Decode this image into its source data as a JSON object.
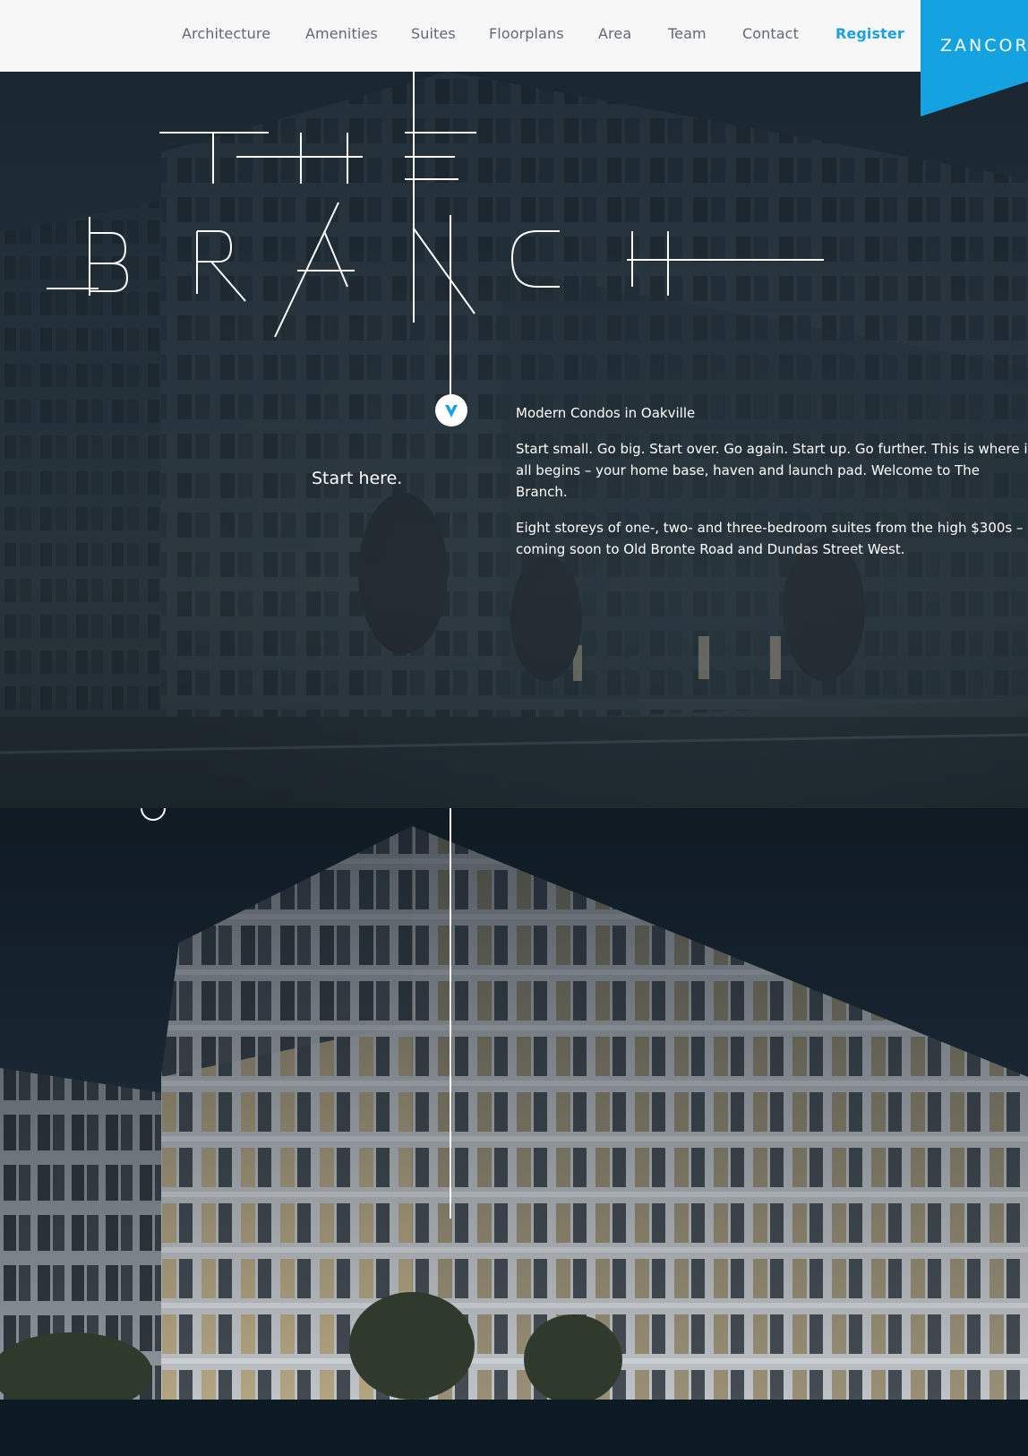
{
  "header": {
    "nav": [
      "Architecture",
      "Amenities",
      "Suites",
      "Floorplans",
      "Area",
      "Team",
      "Contact"
    ],
    "register_label": "Register",
    "logo_text": "ZANCOR",
    "colors": {
      "accent": "#1da1de",
      "nav_text": "#606a70",
      "header_bg": "#f7f7f7",
      "logo_bg": "#14a3e0"
    }
  },
  "hero": {
    "title_line1": "THE",
    "title_line2": "BRANCH",
    "start_label": "Start here.",
    "start_icon": "chevron-down-icon",
    "tagline": "Modern Condos in Oakville",
    "paragraph1": "Start small. Go big. Start over. Go again. Start up. Go further. This is where it all begins – your home base, haven and launch pad. Welcome to The Branch.",
    "paragraph2": "Eight storeys of one-, two- and three-bedroom suites from the high $300s – coming soon to Old Bronte Road and Dundas Street West."
  },
  "render_section": {
    "image": "building-rendering-night"
  }
}
